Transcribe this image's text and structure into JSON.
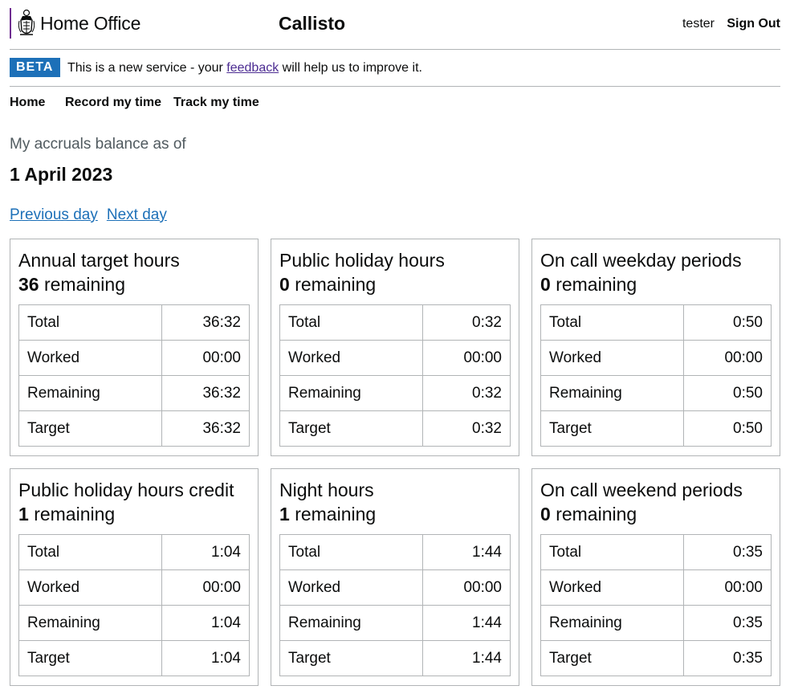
{
  "header": {
    "org_name": "Home Office",
    "service_name": "Callisto",
    "user": "tester",
    "sign_out": "Sign Out"
  },
  "phase_banner": {
    "tag": "BETA",
    "text_before": "This is a new service - your ",
    "link": "feedback",
    "text_after": " will help us to improve it."
  },
  "nav": [
    "Home",
    "Record my time",
    "Track my time"
  ],
  "page": {
    "caption": "My accruals balance as of",
    "date": "1 April 2023",
    "prev_day": "Previous day",
    "next_day": "Next day"
  },
  "row_labels": [
    "Total",
    "Worked",
    "Remaining",
    "Target"
  ],
  "remaining_word": "remaining",
  "cards": [
    {
      "title": "Annual target hours",
      "remaining": "36",
      "rows": [
        "36:32",
        "00:00",
        "36:32",
        "36:32"
      ]
    },
    {
      "title": "Public holiday hours",
      "remaining": "0",
      "rows": [
        "0:32",
        "00:00",
        "0:32",
        "0:32"
      ]
    },
    {
      "title": "On call weekday periods",
      "remaining": "0",
      "rows": [
        "0:50",
        "00:00",
        "0:50",
        "0:50"
      ]
    },
    {
      "title": "Public holiday hours credit",
      "remaining": "1",
      "rows": [
        "1:04",
        "00:00",
        "1:04",
        "1:04"
      ]
    },
    {
      "title": "Night hours",
      "remaining": "1",
      "rows": [
        "1:44",
        "00:00",
        "1:44",
        "1:44"
      ]
    },
    {
      "title": "On call weekend periods",
      "remaining": "0",
      "rows": [
        "0:35",
        "00:00",
        "0:35",
        "0:35"
      ]
    }
  ]
}
